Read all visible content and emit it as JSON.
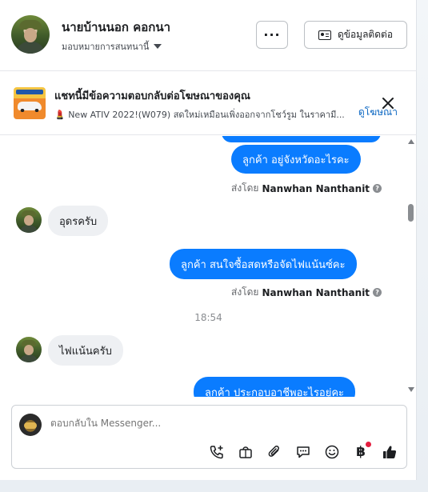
{
  "header": {
    "contact_name": "นายบ้านนอก คอกนา",
    "assign_label": "มอบหมายการสนทนานี้",
    "more_label": "···",
    "contact_info_label": "ดูข้อมูลติดต่อ"
  },
  "ad_banner": {
    "title": "แชทนี้มีข้อความตอบกลับต่อโฆษณาของคุณ",
    "subtitle": "💄 New ATIV 2022!(W079) สดใหม่เหมือนเพิ่งออกจากโชว์รูม ในราคามี...",
    "link_label": "ดูโฆษณา"
  },
  "messages": [
    {
      "side": "out",
      "text": "ลูกค้า   อยู่จังหวัดอะไรคะ"
    },
    {
      "side": "meta",
      "sent_by_prefix": "ส่งโดย",
      "sent_by_name": "Nanwhan Nanthanit"
    },
    {
      "side": "in",
      "text": "อุดรครับ"
    },
    {
      "side": "out",
      "text": "ลูกค้า  สนใจซื้อสดหรือจัดไฟแน้นซ์คะ"
    },
    {
      "side": "meta",
      "sent_by_prefix": "ส่งโดย",
      "sent_by_name": "Nanwhan Nanthanit"
    },
    {
      "side": "time",
      "text": "18:54"
    },
    {
      "side": "in",
      "text": "ไฟแน้นครับ"
    },
    {
      "side": "out",
      "text": "ลูกค้า   ประกอบอาชีพอะไรอยู่คะ"
    }
  ],
  "composer": {
    "placeholder": "ตอบกลับใน Messenger...",
    "tools": [
      "call-add-icon",
      "shopping-bag-icon",
      "attachment-icon",
      "saved-reply-icon",
      "emoji-icon",
      "payment-baht-icon",
      "thumbs-up-icon"
    ]
  },
  "colors": {
    "accent": "#0a7cff",
    "link": "#0a66c2",
    "notification_dot": "#e41e3f"
  }
}
